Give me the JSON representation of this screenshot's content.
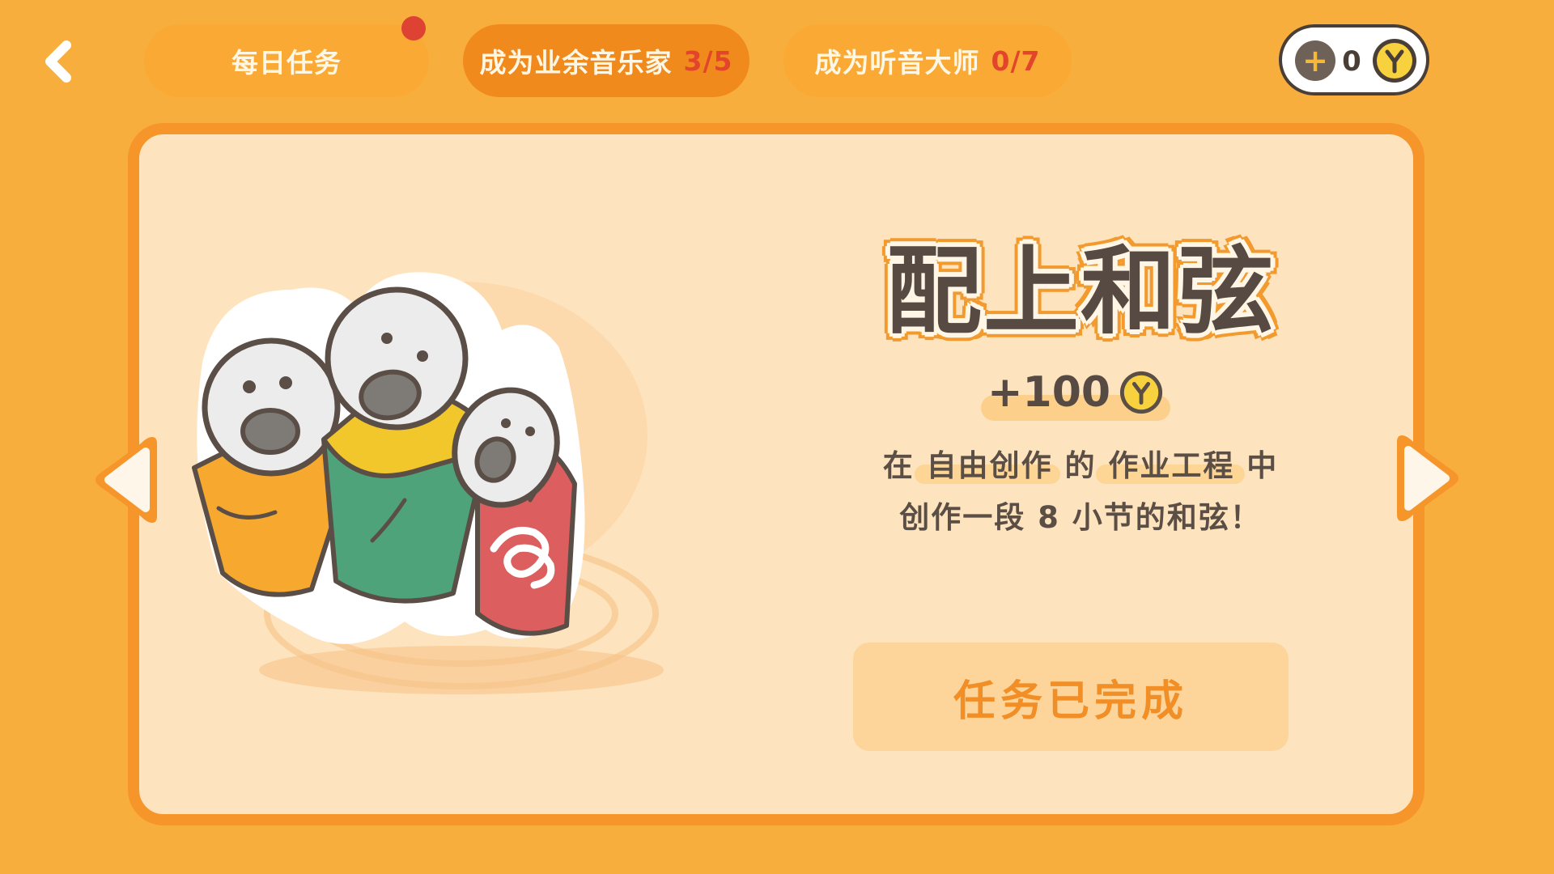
{
  "header": {
    "back_icon": "chevron-left-icon",
    "tabs": [
      {
        "label": "每日任务",
        "progress": "",
        "active": false,
        "has_notification_dot": true
      },
      {
        "label": "成为业余音乐家",
        "progress": "3/5",
        "active": true
      },
      {
        "label": "成为听音大师",
        "progress": "0/7",
        "active": false
      }
    ],
    "coins": {
      "plus_label": "+",
      "count": "0",
      "icon": "coin-icon"
    }
  },
  "task": {
    "title": "配上和弦",
    "reward": "+100",
    "description_line1": "在 自由创作 的 作业工程 中",
    "description_line2": "创作一段 8 小节的和弦！",
    "button_label": "任务已完成"
  },
  "navigation": {
    "prev_icon": "arrow-left-icon",
    "next_icon": "arrow-right-icon"
  },
  "colors": {
    "background": "#f8ae3c",
    "active_tab": "#f18a1d",
    "progress_red": "#e2452c",
    "card_border": "#f6962a",
    "card_fill": "#fee4be",
    "title_outline": "#f29a2e",
    "button_fill": "#fdd59a",
    "button_text": "#f28e26"
  }
}
